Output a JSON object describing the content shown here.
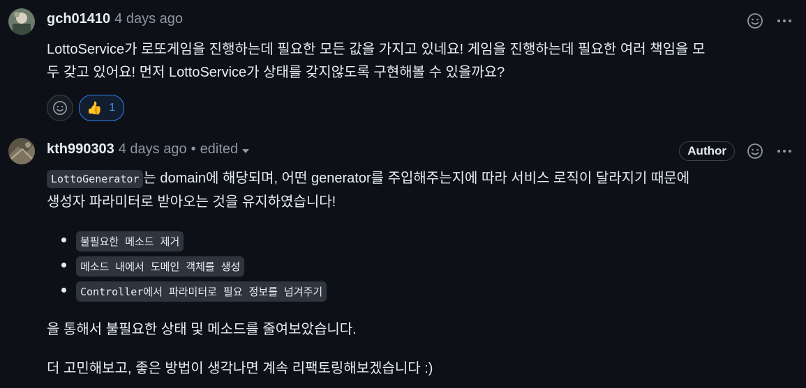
{
  "comments": [
    {
      "author": "gch01410",
      "timestamp": "4 days ago",
      "body_lines": [
        "LottoService가 로또게임을 진행하는데 필요한 모든 값을 가지고 있네요! 게임을 진행하는데 필요한 여러 책임을 모",
        "두 갖고 있어요! 먼저 LottoService가 상태를 갖지않도록 구현해볼 수 있을까요?"
      ],
      "reactions": [
        {
          "emoji": "👍",
          "count": "1",
          "icon": "thumbs-up-icon"
        }
      ]
    },
    {
      "author": "kth990303",
      "timestamp": "4 days ago",
      "separator": "•",
      "edited_label": "edited",
      "badge": "Author",
      "intro": {
        "code": "LottoGenerator",
        "line1_rest": "는 domain에 해당되며, 어떤 generator를 주입해주는지에 따라 서비스 로직이 달라지기 때문에",
        "line2": "생성자 파라미터로 받아오는 것을 유지하였습니다!"
      },
      "bullets": [
        "불필요한 메소드 제거",
        "메소드 내에서 도메인 객체를 생성",
        "Controller에서 파라미터로 필요 정보를 넘겨주기"
      ],
      "paragraph1": "을 통해서 불필요한 상태 및 메소드를 줄여보았습니다.",
      "paragraph2": "더 고민해보고, 좋은 방법이 생각나면 계속 리팩토링해보겠습니다 :)"
    }
  ],
  "colors": {
    "background": "#0d1117",
    "text": "#e6edf3",
    "muted": "#8d96a0",
    "accent": "#4493f8"
  }
}
